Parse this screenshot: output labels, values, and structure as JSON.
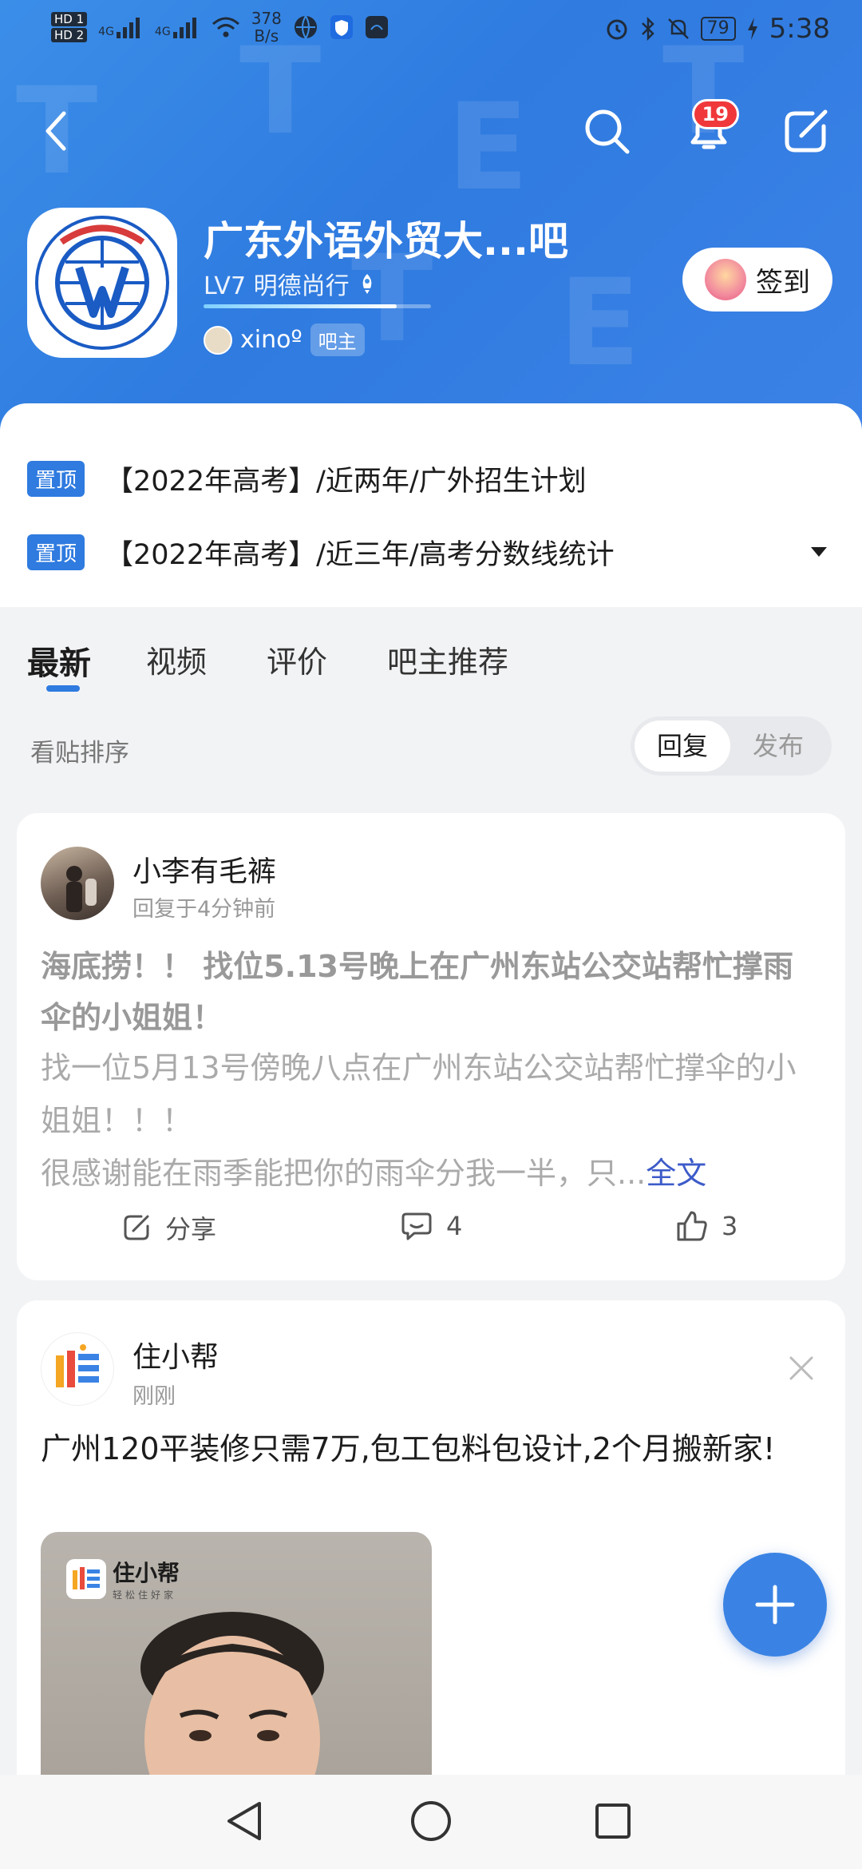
{
  "status_bar": {
    "network_chips": [
      "HD 1",
      "HD 2"
    ],
    "signal_labels": [
      "4G",
      "4G"
    ],
    "speed_value": "378",
    "speed_unit": "B/s",
    "battery": "79",
    "time": "5:38"
  },
  "header": {
    "notification_count": "19",
    "forum_title": "广东外语外贸大...吧",
    "level_text": "LV7 明德尚行",
    "level_progress": 0.85,
    "owner_name": "xinoº",
    "owner_tag": "吧主",
    "signin_label": "签到"
  },
  "pinned": [
    {
      "tag": "置顶",
      "text": "【2022年高考】/近两年/广外招生计划"
    },
    {
      "tag": "置顶",
      "text": "【2022年高考】/近三年/高考分数线统计"
    }
  ],
  "tabs": [
    {
      "label": "最新",
      "active": true
    },
    {
      "label": "视频",
      "active": false
    },
    {
      "label": "评价",
      "active": false
    },
    {
      "label": "吧主推荐",
      "active": false
    }
  ],
  "sort": {
    "label": "看贴排序",
    "option_reply": "回复",
    "option_publish": "发布",
    "selected": "回复"
  },
  "post": {
    "user": "小李有毛裤",
    "time": "回复于4分钟前",
    "title": "海底捞！！ 找位5.13号晚上在广州东站公交站帮忙撑雨伞的小姐姐！",
    "body_line1": "找一位5月13号傍晚八点在广州东站公交站帮忙撑伞的小姐姐！！！",
    "body_line2": "很感谢能在雨季能把你的雨伞分我一半，只...",
    "more": "全文",
    "share_label": "分享",
    "comment_count": "4",
    "like_count": "3"
  },
  "ad": {
    "user": "住小帮",
    "time": "刚刚",
    "text": "广州120平装修只需7万,包工包料包设计,2个月搬新家!",
    "image_brand": "住小帮",
    "image_slogan": "轻松住好家"
  },
  "colors": {
    "header_blue": "#2f7be0",
    "accent_blue": "#3a83e4",
    "badge_red": "#f0383b",
    "link": "#3d5bc9"
  }
}
